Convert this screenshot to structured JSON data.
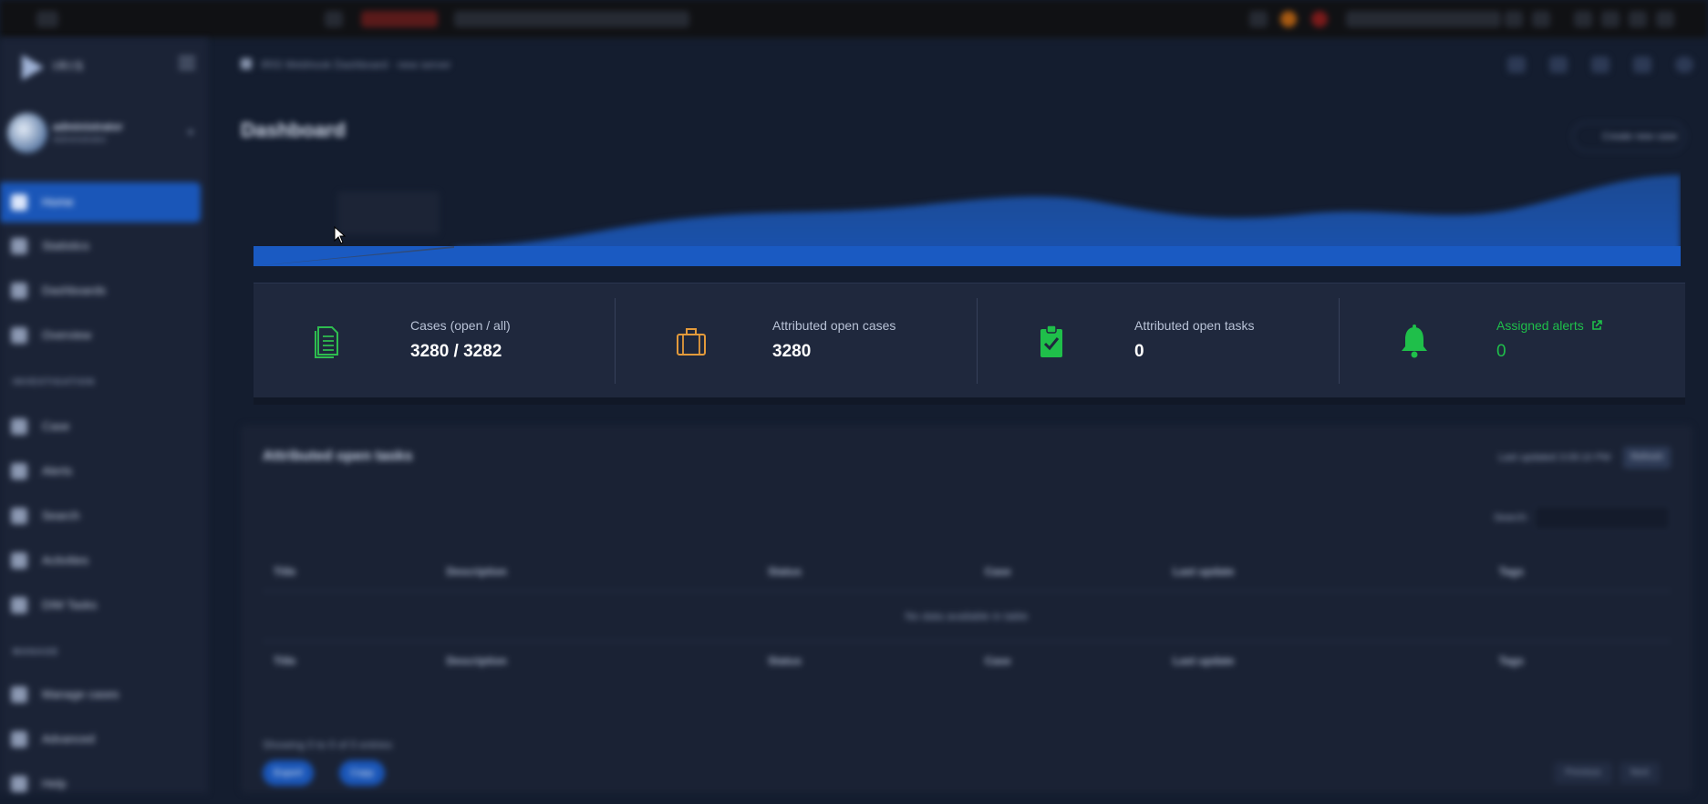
{
  "browser": {
    "recording_label": "REC",
    "tab_title": "IRIS Dashboard"
  },
  "sidebar": {
    "logo_text": "IRIS",
    "user": {
      "name": "administrator",
      "role": "Administrator"
    },
    "items": [
      {
        "label": "Home",
        "icon": "home-icon",
        "active": true
      },
      {
        "label": "Statistics",
        "icon": "chart-icon"
      },
      {
        "label": "Dashboards",
        "icon": "dashboard-icon"
      },
      {
        "label": "Overview",
        "icon": "overview-icon"
      }
    ],
    "section_investigation": "INVESTIGATION",
    "investigation_items": [
      {
        "label": "Case",
        "icon": "case-icon"
      },
      {
        "label": "Alerts",
        "icon": "alert-icon"
      },
      {
        "label": "Search",
        "icon": "search-icon"
      },
      {
        "label": "Activities",
        "icon": "activities-icon"
      },
      {
        "label": "DIM Tasks",
        "icon": "tasks-icon"
      }
    ],
    "section_manage": "MANAGE",
    "manage_items": [
      {
        "label": "Manage cases",
        "icon": "manage-cases-icon"
      },
      {
        "label": "Advanced",
        "icon": "advanced-icon"
      },
      {
        "label": "Help",
        "icon": "help-icon"
      }
    ]
  },
  "header": {
    "breadcrumb": "IRIS Webhook Dashboard · new server"
  },
  "page": {
    "title": "Dashboard",
    "trial_button": "Create new case"
  },
  "stats": [
    {
      "label": "Cases (open / all)",
      "value": "3280 / 3282",
      "icon": "document-icon",
      "color": "#2ebd4f"
    },
    {
      "label": "Attributed open cases",
      "value": "3280",
      "icon": "briefcase-icon",
      "color": "#e39a3b"
    },
    {
      "label": "Attributed open tasks",
      "value": "0",
      "icon": "clipboard-check-icon",
      "color": "#1fbf4a"
    },
    {
      "label": "Assigned alerts",
      "value": "0",
      "icon": "bell-icon",
      "color": "#1fbf4a"
    }
  ],
  "tasks_card": {
    "title": "Attributed open tasks",
    "last_updated": "Last updated 3:09:10 PM",
    "refresh": "Refresh",
    "search_label": "Search:",
    "columns": [
      "Title",
      "Description",
      "Status",
      "Case",
      "Last update",
      "Tags"
    ],
    "empty_text": "No data available in table",
    "showing": "Showing 0 to 0 of 0 entries",
    "buttons": [
      "Export",
      "Copy"
    ],
    "pager": [
      "Previous",
      "Next"
    ]
  },
  "colors": {
    "accent": "#1a56b8",
    "success": "#1fbf4a",
    "warning": "#e39a3b"
  }
}
